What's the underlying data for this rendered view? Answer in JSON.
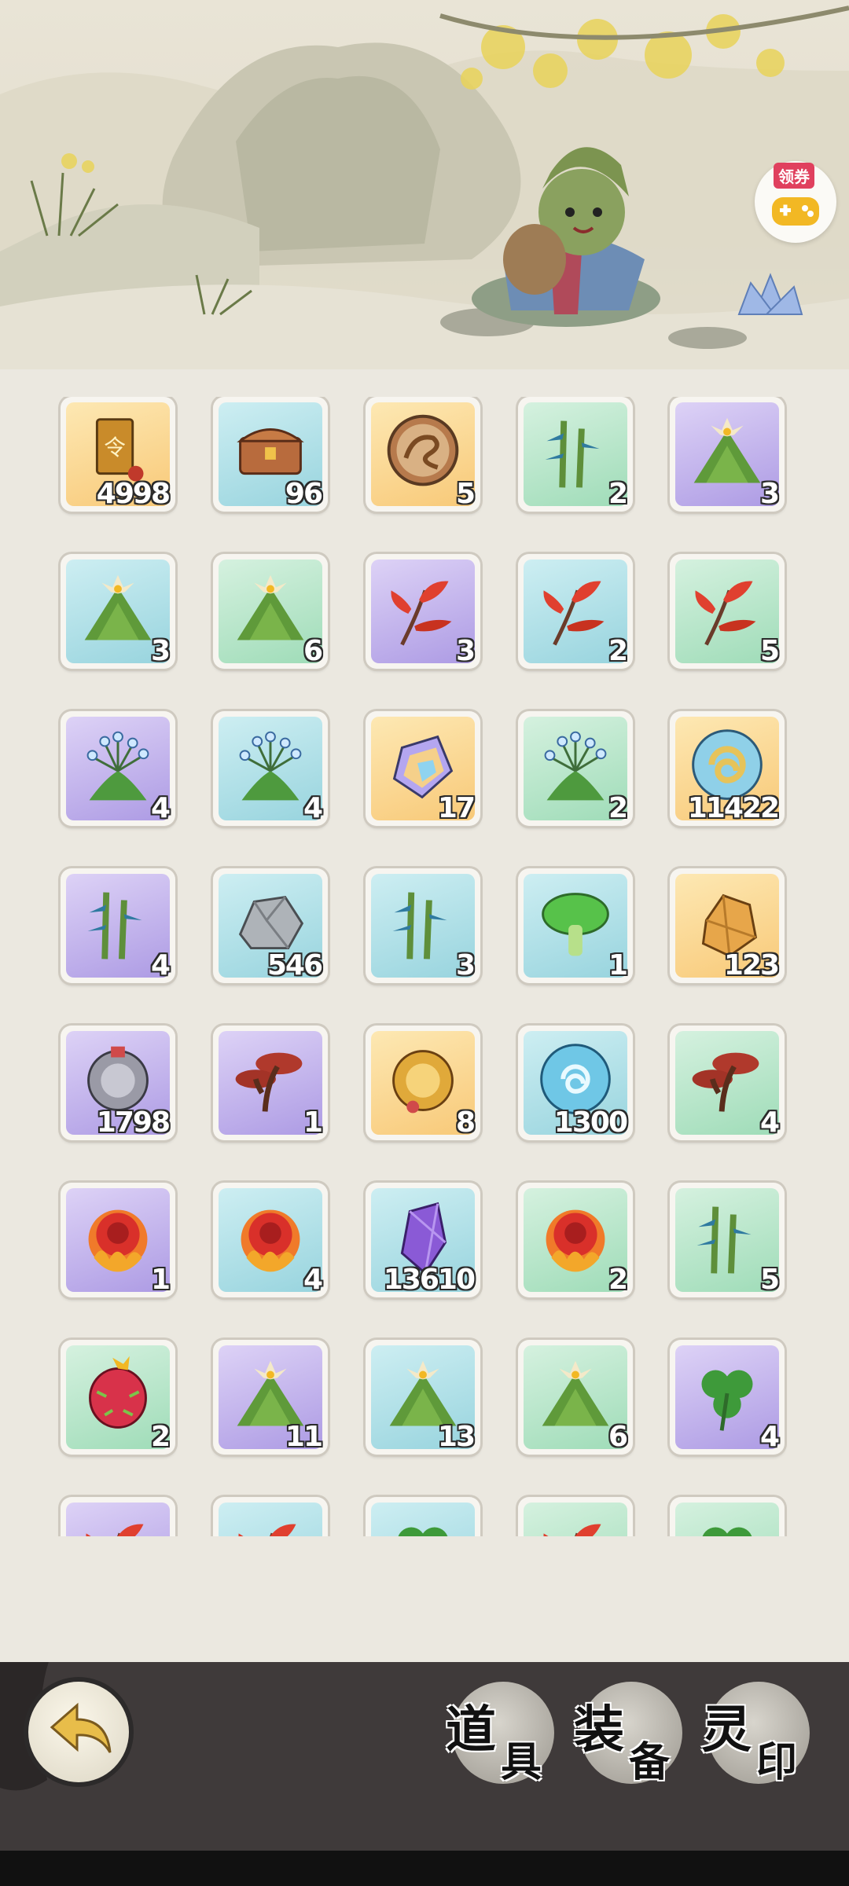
{
  "coupon": {
    "label": "领券"
  },
  "items": [
    {
      "icon": "gold-token-icon",
      "rarity": "gold",
      "count": "4998"
    },
    {
      "icon": "treasure-chest-icon",
      "rarity": "blue",
      "count": "96"
    },
    {
      "icon": "dragon-coin-icon",
      "rarity": "gold",
      "count": "5"
    },
    {
      "icon": "bamboo-icon",
      "rarity": "green",
      "count": "2"
    },
    {
      "icon": "lily-herb-icon",
      "rarity": "purple",
      "count": "3"
    },
    {
      "icon": "lily-herb-icon",
      "rarity": "blue",
      "count": "3"
    },
    {
      "icon": "lily-herb-icon",
      "rarity": "green",
      "count": "6"
    },
    {
      "icon": "red-leaf-icon",
      "rarity": "purple",
      "count": "3"
    },
    {
      "icon": "red-leaf-icon",
      "rarity": "blue",
      "count": "2"
    },
    {
      "icon": "red-leaf-icon",
      "rarity": "green",
      "count": "5"
    },
    {
      "icon": "blue-flower-grass-icon",
      "rarity": "purple",
      "count": "4"
    },
    {
      "icon": "blue-flower-grass-icon",
      "rarity": "blue",
      "count": "4"
    },
    {
      "icon": "rainbow-crystal-icon",
      "rarity": "gold",
      "count": "17"
    },
    {
      "icon": "blue-flower-grass-icon",
      "rarity": "green",
      "count": "2"
    },
    {
      "icon": "swirl-orb-icon",
      "rarity": "gold",
      "count": "11422"
    },
    {
      "icon": "bamboo-icon",
      "rarity": "purple",
      "count": "4"
    },
    {
      "icon": "stone-ore-icon",
      "rarity": "blue",
      "count": "546"
    },
    {
      "icon": "bamboo-icon",
      "rarity": "blue",
      "count": "3"
    },
    {
      "icon": "green-mushroom-icon",
      "rarity": "blue",
      "count": "1"
    },
    {
      "icon": "gold-crystal-icon",
      "rarity": "gold",
      "count": "123"
    },
    {
      "icon": "silver-lock-icon",
      "rarity": "purple",
      "count": "1798"
    },
    {
      "icon": "red-lingzhi-icon",
      "rarity": "purple",
      "count": "1"
    },
    {
      "icon": "gold-lock-icon",
      "rarity": "gold",
      "count": "8"
    },
    {
      "icon": "water-orb-icon",
      "rarity": "blue",
      "count": "1300"
    },
    {
      "icon": "red-lingzhi-icon",
      "rarity": "green",
      "count": "4"
    },
    {
      "icon": "fire-flower-icon",
      "rarity": "purple",
      "count": "1"
    },
    {
      "icon": "fire-flower-icon",
      "rarity": "blue",
      "count": "4"
    },
    {
      "icon": "purple-crystal-icon",
      "rarity": "blue",
      "count": "13610"
    },
    {
      "icon": "fire-flower-icon",
      "rarity": "green",
      "count": "2"
    },
    {
      "icon": "bamboo-icon",
      "rarity": "green",
      "count": "5"
    },
    {
      "icon": "dragon-fruit-icon",
      "rarity": "green",
      "count": "2"
    },
    {
      "icon": "lily-herb-icon",
      "rarity": "purple",
      "count": "11"
    },
    {
      "icon": "lily-herb-icon",
      "rarity": "blue",
      "count": "13"
    },
    {
      "icon": "lily-herb-icon",
      "rarity": "green",
      "count": "6"
    },
    {
      "icon": "clover-icon",
      "rarity": "purple",
      "count": "4"
    },
    {
      "icon": "red-leaf-icon",
      "rarity": "purple",
      "count": ""
    },
    {
      "icon": "red-leaf-icon",
      "rarity": "blue",
      "count": ""
    },
    {
      "icon": "clover-icon",
      "rarity": "blue",
      "count": ""
    },
    {
      "icon": "red-leaf-icon",
      "rarity": "green",
      "count": ""
    },
    {
      "icon": "clover-icon",
      "rarity": "green",
      "count": ""
    }
  ],
  "tabs": [
    {
      "l1": "道",
      "l2": "具"
    },
    {
      "l1": "装",
      "l2": "备"
    },
    {
      "l1": "灵",
      "l2": "印"
    }
  ]
}
